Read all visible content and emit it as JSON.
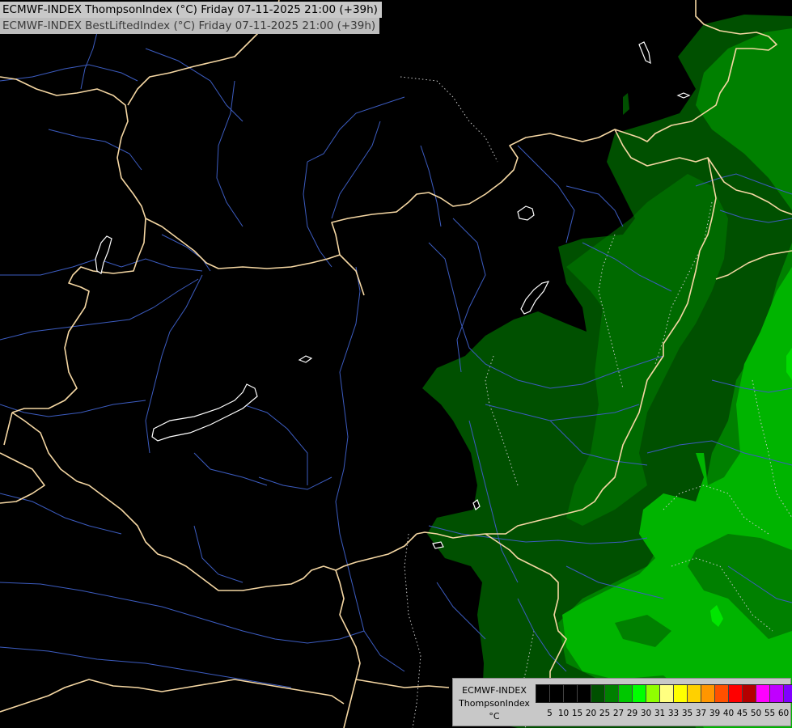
{
  "header": {
    "line1": "ECMWF-INDEX ThompsonIndex (°C) Friday 07-11-2025 21:00 (+39h)",
    "line2": "ECMWF-INDEX BestLiftedIndex (°C) Friday 07-11-2025 21:00 (+39h)"
  },
  "legend": {
    "model": "ECMWF-INDEX",
    "parameter": "ThompsonIndex",
    "unit": "°C",
    "ticks": [
      "5",
      "10",
      "15",
      "20",
      "25",
      "27",
      "29",
      "30",
      "31",
      "33",
      "35",
      "37",
      "39",
      "40",
      "45",
      "50",
      "55",
      "60"
    ],
    "colors": [
      "#000000",
      "#000000",
      "#000000",
      "#000000",
      "#005000",
      "#008000",
      "#00c800",
      "#00ff00",
      "#90ff00",
      "#ffff80",
      "#ffff00",
      "#ffd000",
      "#ff9600",
      "#ff5000",
      "#ff0000",
      "#b40000",
      "#ff00ff",
      "#c000ff",
      "#8000ff",
      "#0000ff"
    ]
  },
  "map": {
    "colors": {
      "background": "#000000",
      "green_dark": "#005000",
      "green_mid": "#008000",
      "green_bright": "#00b400",
      "green_light": "#00ff00",
      "borders": "#f5d7a3",
      "rivers": "#4060c8",
      "contours": "#c8c8c8"
    }
  }
}
